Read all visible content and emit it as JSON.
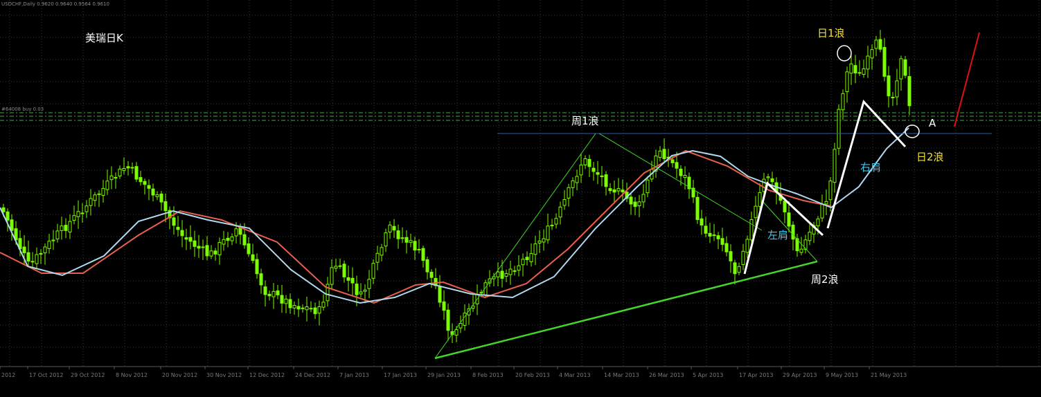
{
  "window": {
    "title_text": "USDCHF,Daily  0.9620 0.9640 0.9564 0.9610"
  },
  "chart_title": "美瑞日K",
  "order_label": "#64008 buy 0.03",
  "x_labels": [
    "2012",
    "17 Oct 2012",
    "29 Oct 2012",
    "8 Nov 2012",
    "20 Nov 2012",
    "30 Nov 2012",
    "12 Dec 2012",
    "24 Dec 2012",
    "7 Jan 2013",
    "17 Jan 2013",
    "29 Jan 2013",
    "8 Feb 2013",
    "20 Feb 2013",
    "4 Mar 2013",
    "14 Mar 2013",
    "26 Mar 2013",
    "5 Apr 2013",
    "17 Apr 2013",
    "29 Apr 2013",
    "9 May 2013",
    "21 May 2013"
  ],
  "annotations": {
    "week_wave1": "周1浪",
    "week_wave2": "周2浪",
    "day_wave1": "日1浪",
    "day_wave2": "日2浪",
    "left_shoulder": "左肩",
    "right_shoulder": "右肩",
    "point_a": "A"
  },
  "colors": {
    "background": "#000000",
    "candle": "#7cfc00",
    "grid": "#3a3a3a",
    "ma_slow": "#e8604c",
    "ma_fast": "#b0d8ee",
    "resistance_line": "#2a5cb0",
    "order_lines": "#3fae3f",
    "trend_line": "#45d62a",
    "pattern_line": "#ffffff",
    "projection": "#e01010",
    "wave_label_white": "#ffffff",
    "wave_label_yellow": "#f2e033",
    "shoulder_label": "#3cc8f0"
  },
  "chart_data": {
    "type": "candlestick",
    "instrument": "USDCHF",
    "timeframe": "Daily",
    "ohlc_last": {
      "open": 0.962,
      "high": 0.964,
      "low": 0.9564,
      "close": 0.961
    },
    "closes_shape_note": "",
    "grid": true,
    "legend": "none"
  }
}
